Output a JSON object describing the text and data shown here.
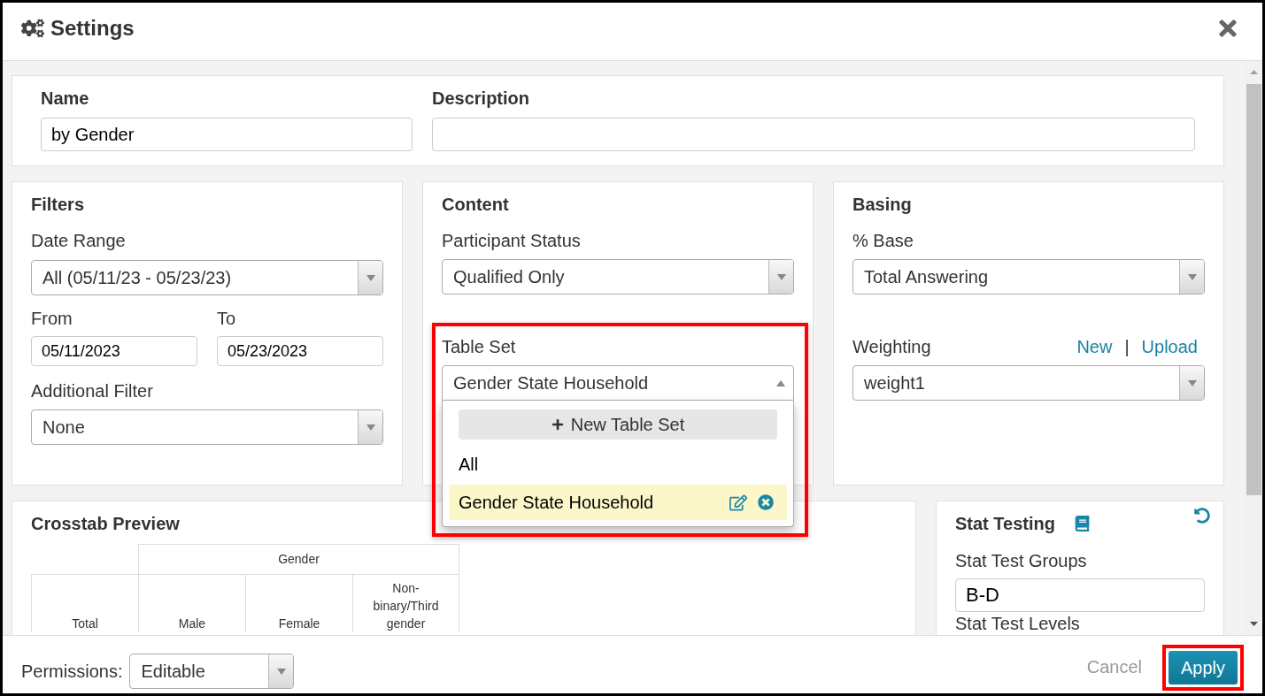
{
  "window": {
    "title": "Settings"
  },
  "general": {
    "name": {
      "label": "Name",
      "value": "by Gender"
    },
    "description": {
      "label": "Description"
    }
  },
  "filters": {
    "title": "Filters",
    "date_range": {
      "label": "Date Range",
      "value": "All (05/11/23 - 05/23/23)"
    },
    "from": {
      "label": "From",
      "value": "05/11/2023"
    },
    "to": {
      "label": "To",
      "value": "05/23/2023"
    },
    "additional_filter": {
      "label": "Additional Filter",
      "value": "None"
    }
  },
  "content": {
    "title": "Content",
    "participant_status": {
      "label": "Participant Status",
      "value": "Qualified Only"
    },
    "table_set": {
      "label": "Table Set",
      "value": "Gender State Household",
      "expanded": true,
      "highlighted": true,
      "new_button": "New Table Set",
      "options": [
        {
          "label": "All",
          "selected": false
        },
        {
          "label": "Gender State Household",
          "selected": true
        }
      ]
    }
  },
  "basing": {
    "title": "Basing",
    "percent_base": {
      "label": "% Base",
      "value": "Total Answering"
    },
    "weighting": {
      "label": "Weighting",
      "value": "weight1",
      "links": [
        "New",
        "Upload"
      ],
      "separator": "|"
    }
  },
  "crosstab_preview": {
    "title": "Crosstab Preview",
    "group_header": "Gender",
    "columns": [
      "Total",
      "Male",
      "Female",
      "Non-binary/Third gender"
    ]
  },
  "stat_testing": {
    "title": "Stat Testing",
    "groups": {
      "label": "Stat Test Groups",
      "value": "B-D"
    },
    "levels": {
      "label": "Stat Test Levels"
    }
  },
  "footer": {
    "permissions": {
      "label": "Permissions:",
      "value": "Editable"
    },
    "buttons": [
      {
        "label": "Cancel",
        "kind": "link"
      },
      {
        "label": "Apply",
        "kind": "primary",
        "highlighted": true
      }
    ]
  }
}
